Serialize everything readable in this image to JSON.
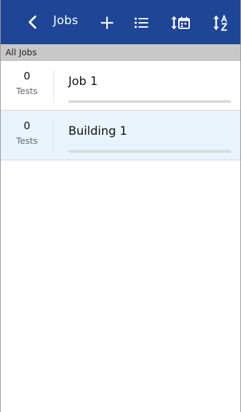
{
  "appbar": {
    "title": "Jobs",
    "icons": [
      "chevron-left-icon",
      "plus-icon",
      "list-icon",
      "sort-by-date-icon",
      "sort-alpha-icon"
    ],
    "color": "#1f4596"
  },
  "subheader": {
    "label": "All Jobs"
  },
  "jobs": [
    {
      "count": "0",
      "count_label": "Tests",
      "name": "Job 1",
      "progress": 0,
      "selected": false
    },
    {
      "count": "0",
      "count_label": "Tests",
      "name": "Building 1",
      "progress": 0,
      "selected": true
    }
  ]
}
